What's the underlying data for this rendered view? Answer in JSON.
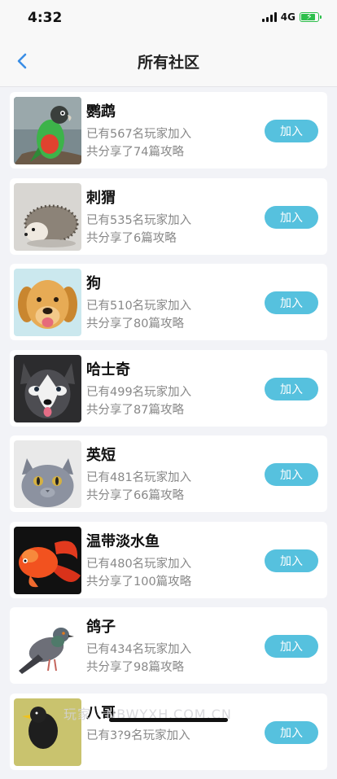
{
  "status": {
    "time": "4:32",
    "network": "4G"
  },
  "nav": {
    "title": "所有社区",
    "back_icon": "chevron-left-icon"
  },
  "accent_color": "#56c1de",
  "communities": [
    {
      "name": "鹦鹉",
      "members": "已有567名玩家加入",
      "guides": "共分享了74篇攻略",
      "join": "加入",
      "image": "parrot"
    },
    {
      "name": "刺猬",
      "members": "已有535名玩家加入",
      "guides": "共分享了6篇攻略",
      "join": "加入",
      "image": "hedgehog"
    },
    {
      "name": "狗",
      "members": "已有510名玩家加入",
      "guides": "共分享了80篇攻略",
      "join": "加入",
      "image": "golden-retriever"
    },
    {
      "name": "哈士奇",
      "members": "已有499名玩家加入",
      "guides": "共分享了87篇攻略",
      "join": "加入",
      "image": "husky"
    },
    {
      "name": "英短",
      "members": "已有481名玩家加入",
      "guides": "共分享了66篇攻略",
      "join": "加入",
      "image": "british-shorthair"
    },
    {
      "name": "温带淡水鱼",
      "members": "已有480名玩家加入",
      "guides": "共分享了100篇攻略",
      "join": "加入",
      "image": "goldfish"
    },
    {
      "name": "鸽子",
      "members": "已有434名玩家加入",
      "guides": "共分享了98篇攻略",
      "join": "加入",
      "image": "pigeon"
    },
    {
      "name": "八哥",
      "members": "已有3?9名玩家加入",
      "guides": "",
      "join": "加入",
      "image": "myna"
    }
  ],
  "watermark": "玩家 · NBWYXH.COM.CN"
}
